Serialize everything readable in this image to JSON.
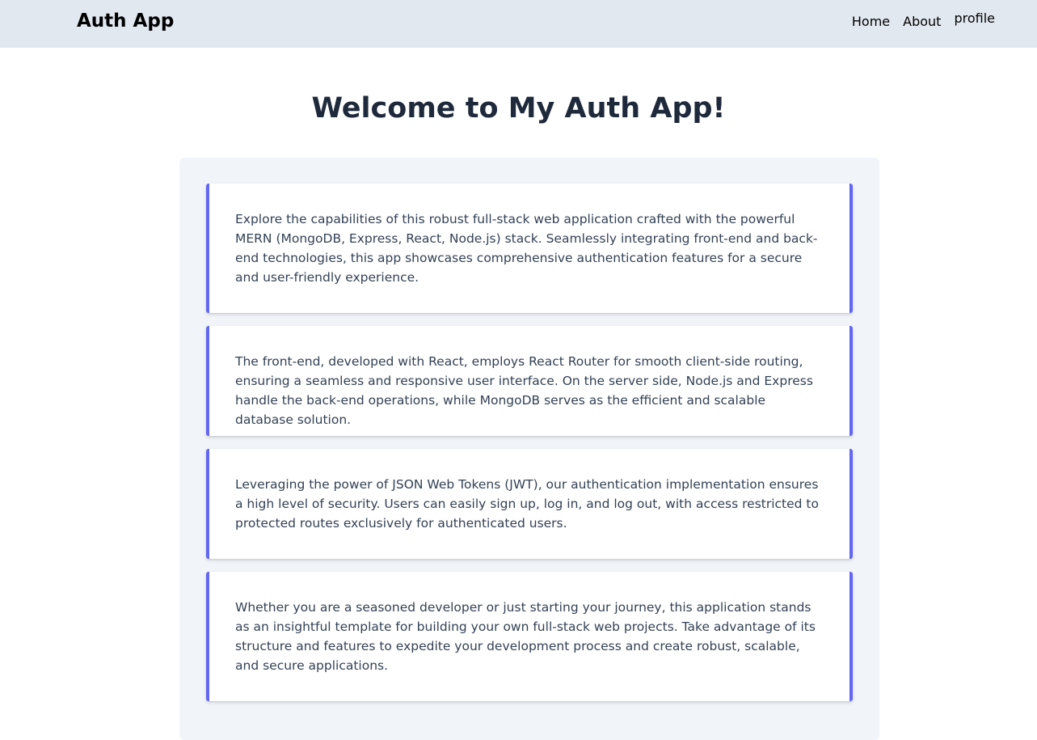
{
  "navbar": {
    "brand": "Auth App",
    "links": [
      "Home",
      "About",
      "profile"
    ]
  },
  "main": {
    "title": "Welcome to My Auth App!",
    "paragraphs": [
      "Explore the capabilities of this robust full-stack web application crafted with the powerful MERN (MongoDB, Express, React, Node.js) stack. Seamlessly integrating front-end and back-end technologies, this app showcases comprehensive authentication features for a secure and user-friendly experience.",
      "The front-end, developed with React, employs React Router for smooth client-side routing, ensuring a seamless and responsive user interface. On the server side, Node.js and Express handle the back-end operations, while MongoDB serves as the efficient and scalable database solution.",
      "Leveraging the power of JSON Web Tokens (JWT), our authentication implementation ensures a high level of security. Users can easily sign up, log in, and log out, with access restricted to protected routes exclusively for authenticated users.",
      "Whether you are a seasoned developer or just starting your journey, this application stands as an insightful template for building your own full-stack web projects. Take advantage of its structure and features to expedite your development process and create robust, scalable, and secure applications."
    ]
  },
  "colors": {
    "navbar_bg": "#e2e8f0",
    "panel_bg": "#f1f5f9",
    "accent": "#6366f1",
    "title": "#1e293b",
    "body_text": "#334155"
  }
}
